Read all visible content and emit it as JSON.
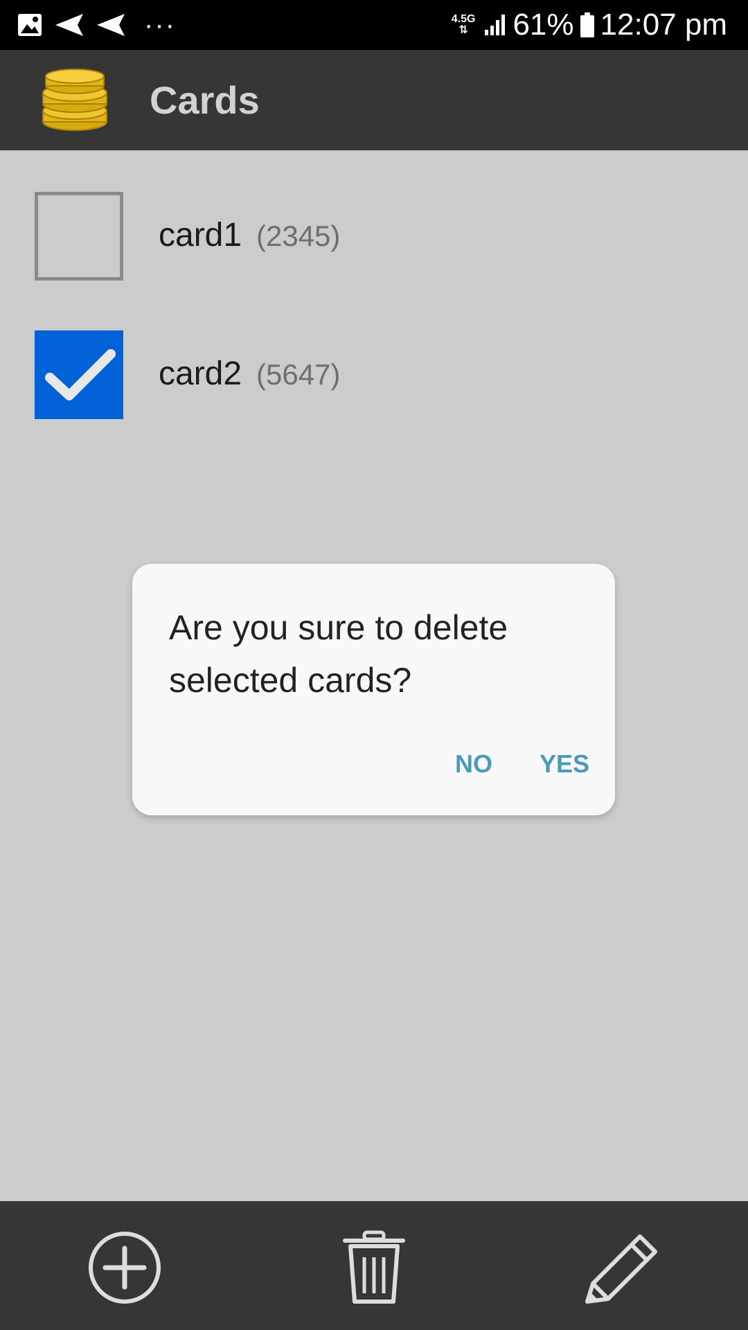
{
  "status_bar": {
    "network_type": "4.5G",
    "battery_percent": "61%",
    "time": "12:07 pm",
    "dots": "···"
  },
  "app_bar": {
    "title": "Cards",
    "logo_icon": "coins-stack-icon"
  },
  "cards": [
    {
      "name": "card1",
      "number": "(2345)",
      "checked": false
    },
    {
      "name": "card2",
      "number": "(5647)",
      "checked": true
    }
  ],
  "dialog": {
    "message": "Are you sure to delete selected cards?",
    "no_label": "NO",
    "yes_label": "YES"
  },
  "bottom_bar": {
    "icons": [
      "add-circle-icon",
      "trash-icon",
      "pencil-icon"
    ]
  },
  "colors": {
    "checkbox_checked": "#0062d6",
    "dialog_button": "#4a9bba",
    "bars": "#363636",
    "background": "#cccccc"
  }
}
